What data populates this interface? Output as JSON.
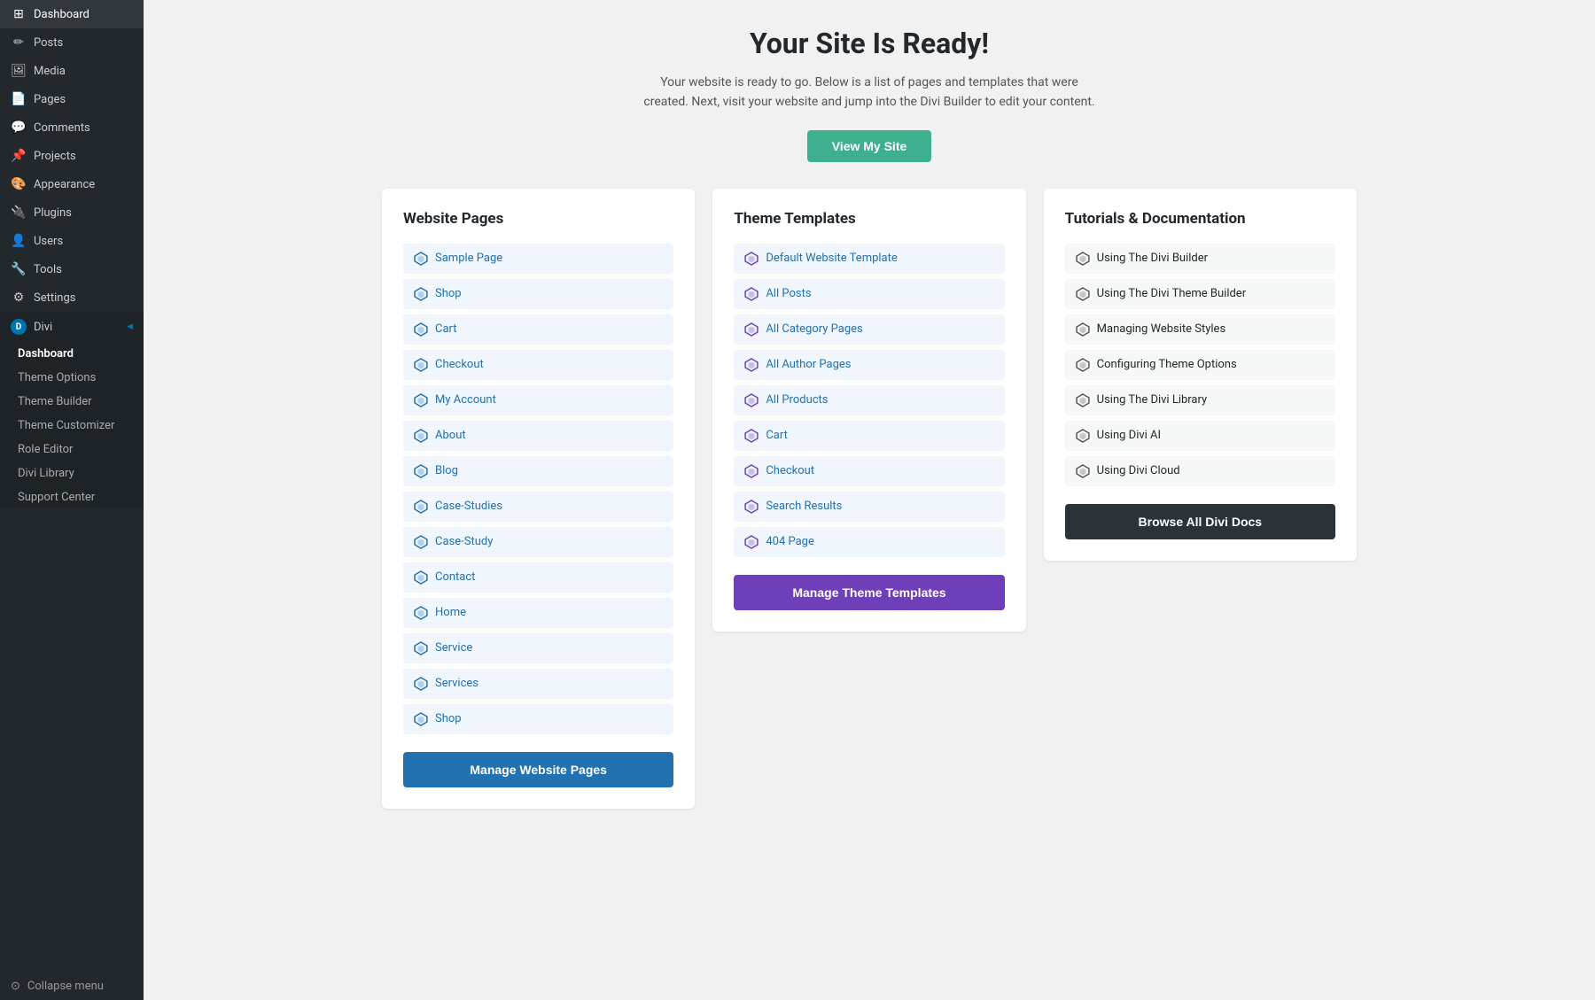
{
  "sidebar": {
    "items": [
      {
        "id": "dashboard",
        "label": "Dashboard",
        "icon": "⊞"
      },
      {
        "id": "posts",
        "label": "Posts",
        "icon": "📝"
      },
      {
        "id": "media",
        "label": "Media",
        "icon": "🖼"
      },
      {
        "id": "pages",
        "label": "Pages",
        "icon": "📄"
      },
      {
        "id": "comments",
        "label": "Comments",
        "icon": "💬"
      },
      {
        "id": "projects",
        "label": "Projects",
        "icon": "📌"
      },
      {
        "id": "appearance",
        "label": "Appearance",
        "icon": "🎨"
      },
      {
        "id": "plugins",
        "label": "Plugins",
        "icon": "🔌"
      },
      {
        "id": "users",
        "label": "Users",
        "icon": "👤"
      },
      {
        "id": "tools",
        "label": "Tools",
        "icon": "🔧"
      },
      {
        "id": "settings",
        "label": "Settings",
        "icon": "⚙"
      }
    ],
    "divi_section": {
      "label": "Divi",
      "sub_items": [
        {
          "id": "dashboard",
          "label": "Dashboard",
          "active": true
        },
        {
          "id": "theme-options",
          "label": "Theme Options"
        },
        {
          "id": "theme-builder",
          "label": "Theme Builder"
        },
        {
          "id": "theme-customizer",
          "label": "Theme Customizer"
        },
        {
          "id": "role-editor",
          "label": "Role Editor"
        },
        {
          "id": "divi-library",
          "label": "Divi Library"
        },
        {
          "id": "support-center",
          "label": "Support Center"
        }
      ]
    },
    "collapse_label": "Collapse menu"
  },
  "page": {
    "title": "Your Site Is Ready!",
    "subtitle": "Your website is ready to go. Below is a list of pages and templates that were created. Next, visit your website and jump into the Divi Builder to edit your content.",
    "view_site_btn": "View My Site"
  },
  "website_pages": {
    "heading": "Website Pages",
    "items": [
      "Sample Page",
      "Shop",
      "Cart",
      "Checkout",
      "My Account",
      "About",
      "Blog",
      "Case-Studies",
      "Case-Study",
      "Contact",
      "Home",
      "Service",
      "Services",
      "Shop"
    ],
    "button": "Manage Website Pages"
  },
  "theme_templates": {
    "heading": "Theme Templates",
    "items": [
      "Default Website Template",
      "All Posts",
      "All Category Pages",
      "All Author Pages",
      "All Products",
      "Cart",
      "Checkout",
      "Search Results",
      "404 Page"
    ],
    "button": "Manage Theme Templates"
  },
  "tutorials": {
    "heading": "Tutorials & Documentation",
    "items": [
      "Using The Divi Builder",
      "Using The Divi Theme Builder",
      "Managing Website Styles",
      "Configuring Theme Options",
      "Using The Divi Library",
      "Using Divi AI",
      "Using Divi Cloud"
    ],
    "button": "Browse All Divi Docs"
  }
}
